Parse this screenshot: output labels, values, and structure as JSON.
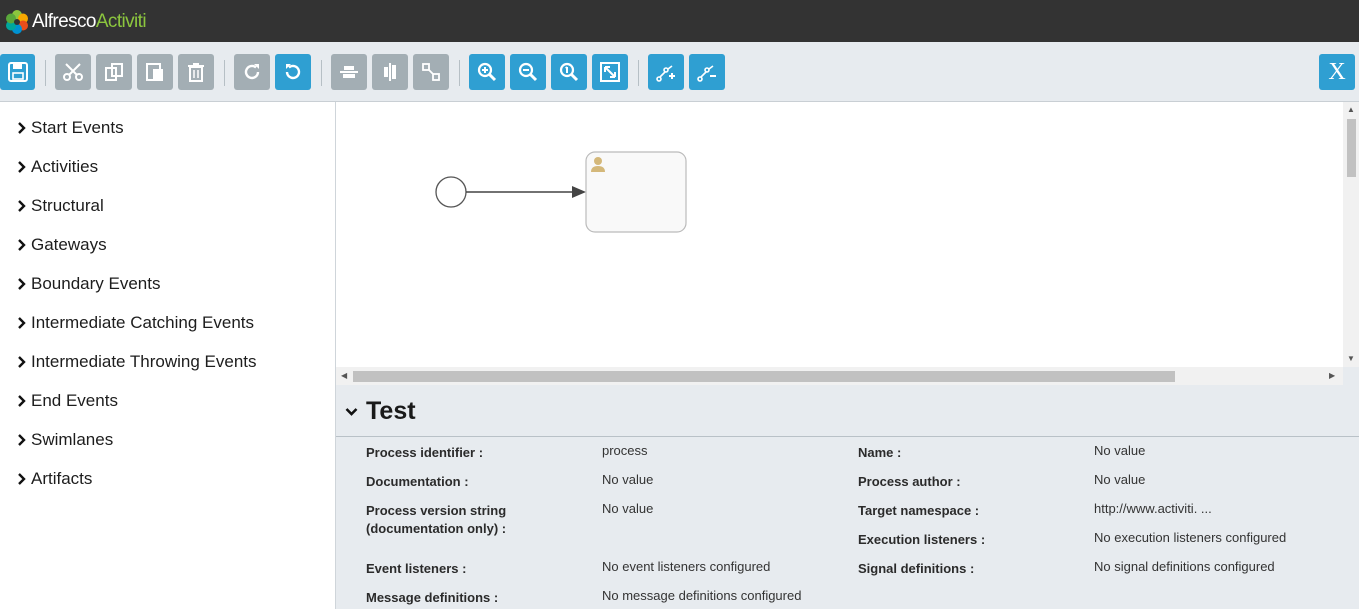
{
  "app": {
    "brand_primary": "Alfresco",
    "brand_secondary": "Activiti"
  },
  "colors": {
    "header": "#333333",
    "toolbar": "#e7ebef",
    "button_active": "#2f9fd2",
    "button_disabled": "#a3aeb4",
    "brand_green": "#8cc63e"
  },
  "toolbar": {
    "buttons": [
      {
        "icon": "save-icon",
        "state": "active"
      },
      {
        "icon": "cut-icon",
        "state": "disabled"
      },
      {
        "icon": "copy-icon",
        "state": "disabled"
      },
      {
        "icon": "paste-icon",
        "state": "disabled"
      },
      {
        "icon": "delete-icon",
        "state": "disabled"
      },
      {
        "icon": "redo-icon",
        "state": "disabled"
      },
      {
        "icon": "undo-icon",
        "state": "active"
      },
      {
        "icon": "align-horizontal-icon",
        "state": "disabled"
      },
      {
        "icon": "align-vertical-icon",
        "state": "disabled"
      },
      {
        "icon": "same-size-icon",
        "state": "disabled"
      },
      {
        "icon": "zoom-in-icon",
        "state": "active"
      },
      {
        "icon": "zoom-out-icon",
        "state": "active"
      },
      {
        "icon": "zoom-actual-icon",
        "state": "active"
      },
      {
        "icon": "zoom-fit-icon",
        "state": "active"
      },
      {
        "icon": "add-bendpoint-icon",
        "state": "active"
      },
      {
        "icon": "remove-bendpoint-icon",
        "state": "active"
      }
    ],
    "close_label": "X"
  },
  "palette": {
    "items": [
      {
        "label": "Start Events"
      },
      {
        "label": "Activities"
      },
      {
        "label": "Structural"
      },
      {
        "label": "Gateways"
      },
      {
        "label": "Boundary Events"
      },
      {
        "label": "Intermediate Catching Events"
      },
      {
        "label": "Intermediate Throwing Events"
      },
      {
        "label": "End Events"
      },
      {
        "label": "Swimlanes"
      },
      {
        "label": "Artifacts"
      }
    ]
  },
  "canvas": {
    "elements": [
      {
        "type": "start-event"
      },
      {
        "type": "sequence-flow"
      },
      {
        "type": "user-task",
        "icon": "user-icon"
      }
    ]
  },
  "properties": {
    "title": "Test",
    "left": [
      {
        "label": "Process identifier :",
        "value": "process"
      },
      {
        "label": "Documentation :",
        "value": "No value"
      },
      {
        "label": "Process version string (documentation only) :",
        "value": "No value"
      },
      {
        "label": "Event listeners :",
        "value": "No event listeners configured"
      },
      {
        "label": "Message definitions :",
        "value": "No message definitions configured"
      }
    ],
    "right": [
      {
        "label": "Name :",
        "value": "No value"
      },
      {
        "label": "Process author :",
        "value": "No value"
      },
      {
        "label": "Target namespace :",
        "value": "http://www.activiti. ..."
      },
      {
        "label": "Execution listeners :",
        "value": "No execution listeners configured"
      },
      {
        "label": "Signal definitions :",
        "value": "No signal definitions configured"
      }
    ]
  }
}
